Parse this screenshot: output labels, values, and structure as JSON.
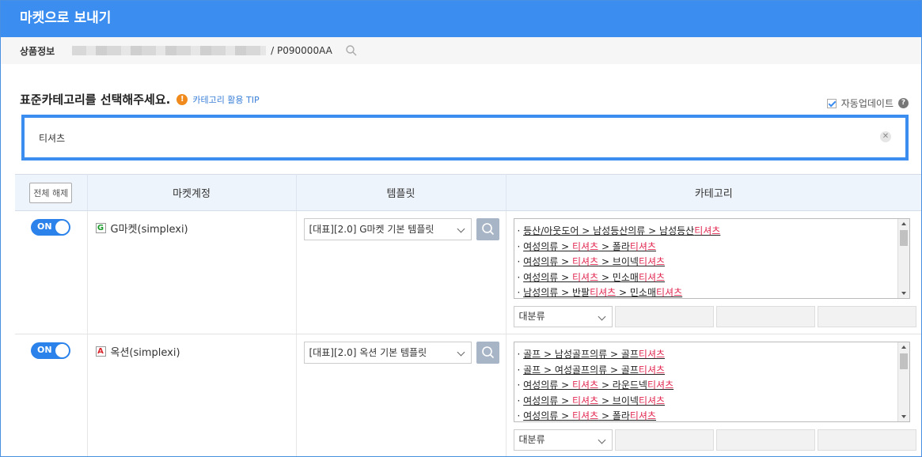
{
  "window": {
    "title": "마켓으로 보내기"
  },
  "product": {
    "label": "상품정보",
    "code": "/ P090000AA"
  },
  "section": {
    "title": "표준카테고리를 선택해주세요.",
    "tip": "카테고리 활용 TIP"
  },
  "auto_update": {
    "label": "자동업데이트",
    "checked": true
  },
  "search": {
    "value": "티셔츠",
    "clear_icon": "close-icon"
  },
  "table": {
    "deselect_all": "전체 해제",
    "headers": [
      "마켓계정",
      "템플릿",
      "카테고리"
    ],
    "rows": [
      {
        "toggle": "ON",
        "market_logo": "G",
        "account": "G마켓(simplexi)",
        "template": "[대표][2.0] G마켓 기본 템플릿",
        "categories": [
          [
            {
              "t": "등산/아웃도어 > 남성등산의류 > 남성등산"
            },
            {
              "t": "티셔츠",
              "h": true
            }
          ],
          [
            {
              "t": "여성의류 > "
            },
            {
              "t": "티셔츠",
              "h": true
            },
            {
              "t": " > 폴라"
            },
            {
              "t": "티셔츠",
              "h": true
            }
          ],
          [
            {
              "t": "여성의류 > "
            },
            {
              "t": "티셔츠",
              "h": true
            },
            {
              "t": " > 브이넥"
            },
            {
              "t": "티셔츠",
              "h": true
            }
          ],
          [
            {
              "t": "여성의류 > "
            },
            {
              "t": "티셔츠",
              "h": true
            },
            {
              "t": " > 민소매"
            },
            {
              "t": "티셔츠",
              "h": true
            }
          ],
          [
            {
              "t": "남성의류 > 반팔"
            },
            {
              "t": "티셔츠",
              "h": true
            },
            {
              "t": " > 민소매"
            },
            {
              "t": "티셔츠",
              "h": true
            }
          ]
        ],
        "level1": "대분류"
      },
      {
        "toggle": "ON",
        "market_logo": "A",
        "account": "옥션(simplexi)",
        "template": "[대표][2.0] 옥션 기본 템플릿",
        "categories": [
          [
            {
              "t": "골프 > 남성골프의류 > 골프"
            },
            {
              "t": "티셔츠",
              "h": true
            }
          ],
          [
            {
              "t": "골프 > 여성골프의류 > 골프"
            },
            {
              "t": "티셔츠",
              "h": true
            }
          ],
          [
            {
              "t": "여성의류 > "
            },
            {
              "t": "티셔츠",
              "h": true
            },
            {
              "t": " > 라운드넥"
            },
            {
              "t": "티셔츠",
              "h": true
            }
          ],
          [
            {
              "t": "여성의류 > "
            },
            {
              "t": "티셔츠",
              "h": true
            },
            {
              "t": " > 브이넥"
            },
            {
              "t": "티셔츠",
              "h": true
            }
          ],
          [
            {
              "t": "여성의류 > "
            },
            {
              "t": "티셔츠",
              "h": true
            },
            {
              "t": " > 폴라"
            },
            {
              "t": "티셔츠",
              "h": true
            }
          ]
        ],
        "level1": "대분류"
      }
    ]
  },
  "colors": {
    "accent": "#3c8df0",
    "highlight": "#e1264f",
    "toggle_on": "#2a82ea"
  }
}
